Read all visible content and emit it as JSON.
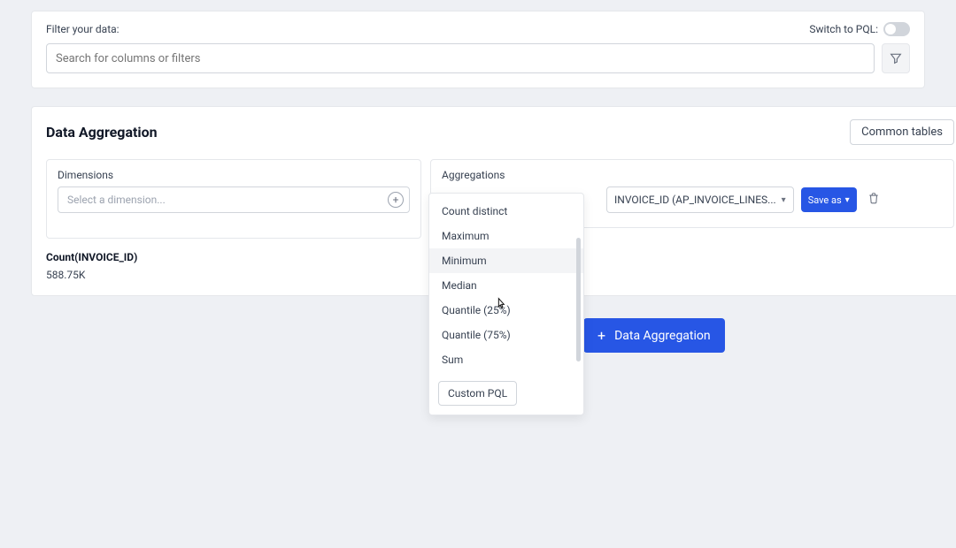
{
  "filter": {
    "label": "Filter your data:",
    "switch_label": "Switch to PQL:",
    "search_placeholder": "Search for columns or filters"
  },
  "aggregation": {
    "title": "Data Aggregation",
    "common_tables": "Common tables",
    "dimensions": {
      "label": "Dimensions",
      "placeholder": "Select a dimension..."
    },
    "aggregations_label": "Aggregations",
    "selected_field": "INVOICE_ID (AP_INVOICE_LINES...",
    "save_as": "Save as",
    "result_label": "Count(INVOICE_ID)",
    "result_value": "588.75K"
  },
  "dropdown": {
    "items": {
      "0": "Count distinct",
      "1": "Maximum",
      "2": "Minimum",
      "3": "Median",
      "4": "Quantile (25%)",
      "5": "Quantile (75%)",
      "6": "Sum"
    },
    "custom_pql": "Custom PQL"
  },
  "big_button": "Data Aggregation"
}
